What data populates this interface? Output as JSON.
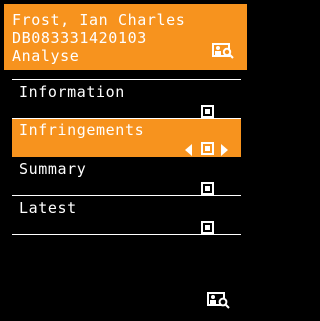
{
  "header": {
    "name": "Frost, Ian Charles",
    "id": "DB083331420103",
    "mode": "Analyse",
    "icon": "person-card-search-icon"
  },
  "menu": {
    "items": [
      {
        "label": "Information",
        "icon": "square-marker-icon"
      },
      {
        "label": "Infringements",
        "icon": "square-marker-icon",
        "selected": true
      },
      {
        "label": "Summary",
        "icon": "square-marker-icon"
      },
      {
        "label": "Latest",
        "icon": "square-marker-icon"
      }
    ]
  },
  "footer": {
    "icon": "person-card-search-icon"
  },
  "colors": {
    "accent": "#f7931e",
    "background": "#000000",
    "text": "#ffffff"
  }
}
